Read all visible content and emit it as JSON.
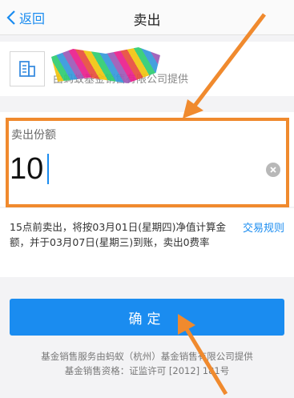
{
  "nav": {
    "back_label": "返回",
    "title": "卖出"
  },
  "fund": {
    "name": "",
    "provider": "由蚂蚁基金销售有限公司提供"
  },
  "sell": {
    "label": "卖出份额",
    "value": "10"
  },
  "info": {
    "text": "15点前卖出，将按03月01日(星期四)净值计算金额，并于03月07日(星期三)到账，卖出0费率",
    "rules_link": "交易规则"
  },
  "confirm_label": "确定",
  "footer": {
    "line1": "基金销售服务由蚂蚁（杭州）基金销售有限公司提供",
    "line2": "基金销售资格：证监许可 [2012] 181号"
  },
  "colors": {
    "accent": "#1a8cf0",
    "annotation": "#f08a2e"
  }
}
